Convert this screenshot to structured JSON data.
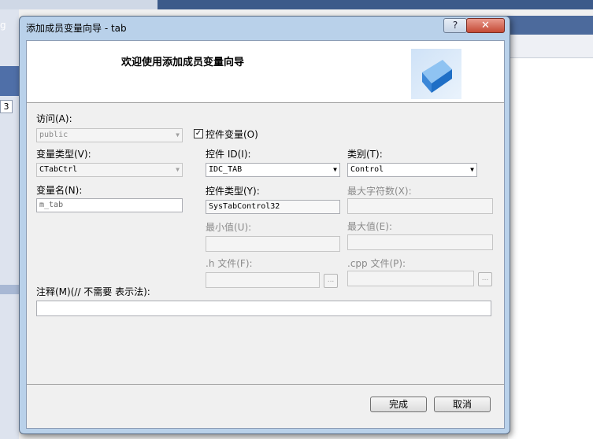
{
  "background": {
    "left_label": "g",
    "left_number": "3"
  },
  "dialog": {
    "title": "添加成员变量向导 - tab",
    "help_label": "?",
    "close_label": "✕",
    "header_title": "欢迎使用添加成员变量向导"
  },
  "form": {
    "access_label": "访问(A):",
    "access_value": "public",
    "control_var_label": "控件变量(O)",
    "control_var_checked": "✓",
    "var_type_label": "变量类型(V):",
    "var_type_value": "CTabCtrl",
    "control_id_label": "控件 ID(I):",
    "control_id_value": "IDC_TAB",
    "category_label": "类别(T):",
    "category_value": "Control",
    "var_name_label": "变量名(N):",
    "var_name_value": "m_tab",
    "control_type_label": "控件类型(Y):",
    "control_type_value": "SysTabControl32",
    "max_chars_label": "最大字符数(X):",
    "min_value_label": "最小值(U):",
    "max_value_label": "最大值(E):",
    "h_file_label": ".h 文件(F):",
    "cpp_file_label": ".cpp 文件(P):",
    "browse_label": "...",
    "comment_label": "注释(M)(// 不需要 表示法):"
  },
  "buttons": {
    "finish": "完成",
    "cancel": "取消"
  }
}
